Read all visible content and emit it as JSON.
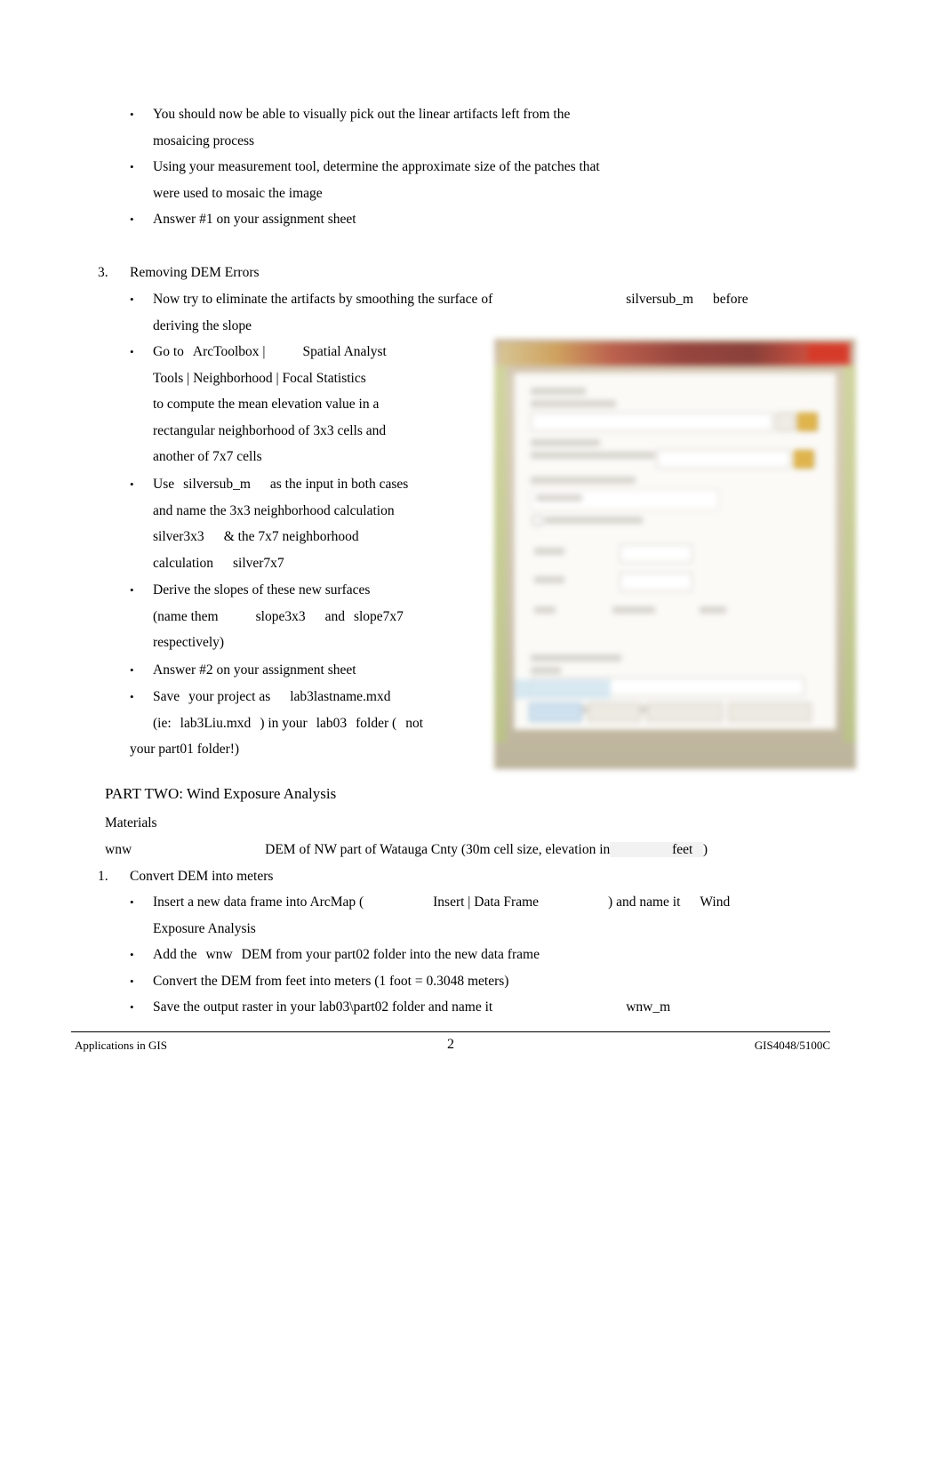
{
  "document": {
    "page_number": "2",
    "footer_left": "Applications in GIS",
    "footer_right": "GIS4048/5100C"
  },
  "bullet_glyph": "•",
  "top_bullets": [
    {
      "l1": "You should now be able to visually pick out the linear artifacts left from the",
      "l2": "mosaicing process"
    },
    {
      "l1": "Using your measurement tool, determine the approximate size of the patches that",
      "l2": "were used to mosaic the image"
    },
    {
      "l1": "Answer #1 on your assignment sheet",
      "l2": ""
    }
  ],
  "section3": {
    "number": "3.",
    "title": "Removing DEM Errors",
    "b1": {
      "pre": "Now try to eliminate the artifacts by smoothing the surface of",
      "code": "silversub_m",
      "post": "before",
      "line2": "deriving the slope"
    },
    "b2": {
      "p1": "Go to",
      "p2": "ArcToolbox |",
      "p3": "Spatial Analyst",
      "p4": "Tools | Neighborhood | Focal Statistics",
      "p5": "to compute the mean elevation value in a",
      "p6": "rectangular neighborhood of 3x3 cells and",
      "p7": "another of 7x7 cells"
    },
    "b3": {
      "p1": "Use",
      "p2": "silversub_m",
      "p3": "as the input in both cases",
      "p4": "and name the 3x3 neighborhood calculation",
      "p5": "silver3x3",
      "p6": "& the 7x7 neighborhood",
      "p7": "calculation",
      "p8": "silver7x7"
    },
    "b4": {
      "p1": "Derive the slopes of these new surfaces",
      "p2": "(name them",
      "p3": "slope3x3",
      "p4": "and",
      "p5": "slope7x7",
      "p6": "respectively)"
    },
    "b5": "Answer #2 on your assignment sheet",
    "b6": {
      "p1": "Save",
      "p2": "your project as",
      "p3": "lab3lastname.mxd",
      "p4": "(ie:",
      "p5": "lab3Liu.mxd",
      "p6": ") in your",
      "p7": "lab03",
      "p8": "folder (",
      "p9": "not",
      "p10": "your part01 folder!)"
    }
  },
  "part_two": {
    "heading": "PART TWO: Wind Exposure Analysis",
    "materials_label": "Materials",
    "materials_row": {
      "name": "wnw",
      "desc": "DEM of NW part of Watauga Cnty (30m cell size, elevation in",
      "unit": "feet",
      "close": ")"
    },
    "step1": {
      "number": "1.",
      "title": "Convert DEM into meters",
      "bullets": [
        {
          "p1": "Insert a new data frame into ArcMap (",
          "p2": "Insert | Data Frame",
          "p3": ") and name it",
          "p4": "Wind",
          "p5": "Exposure Analysis"
        },
        {
          "p1": "Add the",
          "p2": "wnw",
          "p3": "DEM from your part02 folder into the new data frame"
        },
        {
          "p1": "Convert the DEM from feet into meters (1 foot = 0.3048 meters)"
        },
        {
          "p1": "Save the output raster in your lab03\\part02 folder and name it",
          "p2": "wnw_m"
        }
      ]
    }
  },
  "embedded_image": {
    "alt": "blurred screenshot of ArcGIS Focal Statistics tool dialog"
  }
}
